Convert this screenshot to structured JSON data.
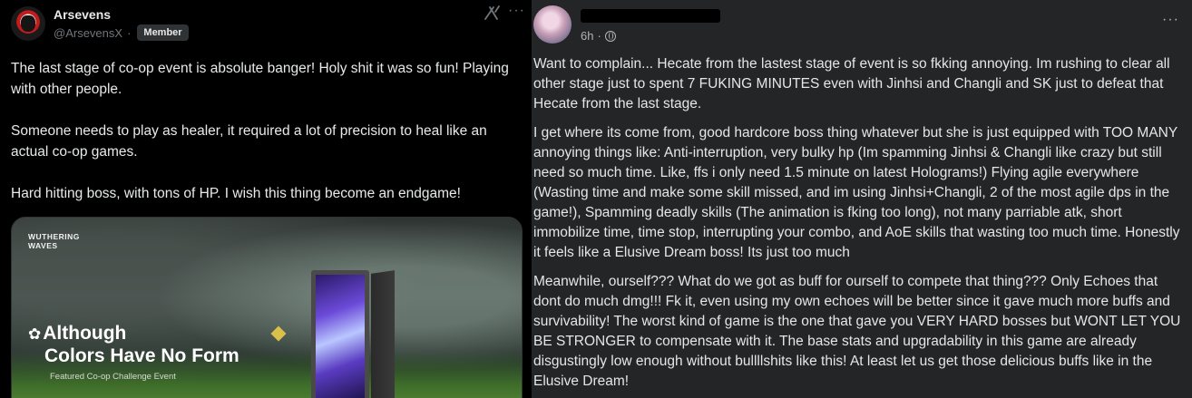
{
  "x_post": {
    "author_name": "Arsevens",
    "handle": "@ArsevensX",
    "separator": "·",
    "badge": "Member",
    "more_label": "···",
    "paragraphs": [
      "The last stage of co-op event is absolute banger! Holy shit it was so fun! Playing with other people.",
      "Someone needs to play as healer, it required a lot of precision to heal like an actual co-op games.",
      "Hard hitting boss, with tons of HP. I wish this thing become an endgame!"
    ],
    "media": {
      "logo_line1": "WUTHERING",
      "logo_line2": "WAVES",
      "title_line1": "Although",
      "title_line2": "Colors Have No Form",
      "subtitle": "Featured Co-op Challenge Event"
    },
    "icons": {
      "grok": "grok-icon",
      "more": "more-icon"
    }
  },
  "fb_post": {
    "time": "6h",
    "separator": "·",
    "more_label": "···",
    "paragraphs": [
      "Want to complain... Hecate from the lastest stage of event is so fkking annoying. Im rushing to clear all other stage just to spent 7 FUKING MINUTES even with Jinhsi and Changli and SK just to defeat that Hecate from the last stage.",
      "I get where its come from, good hardcore boss thing whatever but she is just equipped with TOO MANY annoying things like: Anti-interruption, very bulky hp (Im spamming Jinhsi & Changli like crazy but still need so much time. Like, ffs i only need 1.5 minute on latest Holograms!) Flying agile everywhere (Wasting time and make some skill missed, and im using Jinhsi+Changli, 2 of the most agile dps in the game!), Spamming deadly skills (The animation is fking too long), not many parriable atk, short immobilize time, time stop, interrupting your combo, and AoE skills that wasting too much time. Honestly it feels like a Elusive Dream boss! Its just too much",
      "Meanwhile, ourself??? What do we got as buff for ourself to compete that thing??? Only Echoes that dont do much dmg!!! Fk it, even using my own echoes will be better since it gave much more buffs and survivability! The worst kind of game is the one that gave you VERY HARD bosses but WONT LET YOU BE STRONGER to compensate with it. The base stats and upgradability in this game are already disgustingly low enough without bullllshits like this! At least let us get those delicious buffs like in the Elusive Dream!"
    ],
    "icons": {
      "privacy": "globe-icon",
      "more": "more-icon"
    }
  },
  "colors": {
    "x_background": "#000000",
    "fb_background": "#242526",
    "x_text": "#e7e9ea",
    "x_secondary": "#71767b",
    "fb_text": "#e4e6eb",
    "fb_secondary": "#b0b3b8"
  }
}
